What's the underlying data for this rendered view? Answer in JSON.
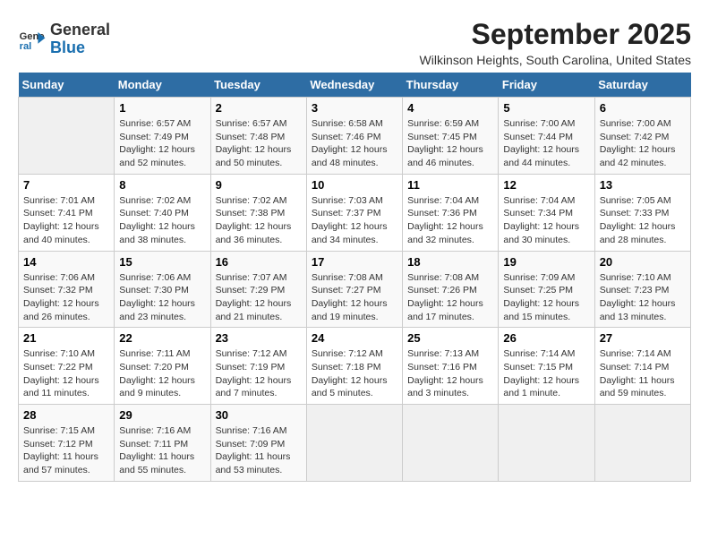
{
  "header": {
    "logo_line1": "General",
    "logo_line2": "Blue",
    "month": "September 2025",
    "location": "Wilkinson Heights, South Carolina, United States"
  },
  "days_of_week": [
    "Sunday",
    "Monday",
    "Tuesday",
    "Wednesday",
    "Thursday",
    "Friday",
    "Saturday"
  ],
  "weeks": [
    [
      {
        "day": "",
        "info": ""
      },
      {
        "day": "1",
        "info": "Sunrise: 6:57 AM\nSunset: 7:49 PM\nDaylight: 12 hours\nand 52 minutes."
      },
      {
        "day": "2",
        "info": "Sunrise: 6:57 AM\nSunset: 7:48 PM\nDaylight: 12 hours\nand 50 minutes."
      },
      {
        "day": "3",
        "info": "Sunrise: 6:58 AM\nSunset: 7:46 PM\nDaylight: 12 hours\nand 48 minutes."
      },
      {
        "day": "4",
        "info": "Sunrise: 6:59 AM\nSunset: 7:45 PM\nDaylight: 12 hours\nand 46 minutes."
      },
      {
        "day": "5",
        "info": "Sunrise: 7:00 AM\nSunset: 7:44 PM\nDaylight: 12 hours\nand 44 minutes."
      },
      {
        "day": "6",
        "info": "Sunrise: 7:00 AM\nSunset: 7:42 PM\nDaylight: 12 hours\nand 42 minutes."
      }
    ],
    [
      {
        "day": "7",
        "info": "Sunrise: 7:01 AM\nSunset: 7:41 PM\nDaylight: 12 hours\nand 40 minutes."
      },
      {
        "day": "8",
        "info": "Sunrise: 7:02 AM\nSunset: 7:40 PM\nDaylight: 12 hours\nand 38 minutes."
      },
      {
        "day": "9",
        "info": "Sunrise: 7:02 AM\nSunset: 7:38 PM\nDaylight: 12 hours\nand 36 minutes."
      },
      {
        "day": "10",
        "info": "Sunrise: 7:03 AM\nSunset: 7:37 PM\nDaylight: 12 hours\nand 34 minutes."
      },
      {
        "day": "11",
        "info": "Sunrise: 7:04 AM\nSunset: 7:36 PM\nDaylight: 12 hours\nand 32 minutes."
      },
      {
        "day": "12",
        "info": "Sunrise: 7:04 AM\nSunset: 7:34 PM\nDaylight: 12 hours\nand 30 minutes."
      },
      {
        "day": "13",
        "info": "Sunrise: 7:05 AM\nSunset: 7:33 PM\nDaylight: 12 hours\nand 28 minutes."
      }
    ],
    [
      {
        "day": "14",
        "info": "Sunrise: 7:06 AM\nSunset: 7:32 PM\nDaylight: 12 hours\nand 26 minutes."
      },
      {
        "day": "15",
        "info": "Sunrise: 7:06 AM\nSunset: 7:30 PM\nDaylight: 12 hours\nand 23 minutes."
      },
      {
        "day": "16",
        "info": "Sunrise: 7:07 AM\nSunset: 7:29 PM\nDaylight: 12 hours\nand 21 minutes."
      },
      {
        "day": "17",
        "info": "Sunrise: 7:08 AM\nSunset: 7:27 PM\nDaylight: 12 hours\nand 19 minutes."
      },
      {
        "day": "18",
        "info": "Sunrise: 7:08 AM\nSunset: 7:26 PM\nDaylight: 12 hours\nand 17 minutes."
      },
      {
        "day": "19",
        "info": "Sunrise: 7:09 AM\nSunset: 7:25 PM\nDaylight: 12 hours\nand 15 minutes."
      },
      {
        "day": "20",
        "info": "Sunrise: 7:10 AM\nSunset: 7:23 PM\nDaylight: 12 hours\nand 13 minutes."
      }
    ],
    [
      {
        "day": "21",
        "info": "Sunrise: 7:10 AM\nSunset: 7:22 PM\nDaylight: 12 hours\nand 11 minutes."
      },
      {
        "day": "22",
        "info": "Sunrise: 7:11 AM\nSunset: 7:20 PM\nDaylight: 12 hours\nand 9 minutes."
      },
      {
        "day": "23",
        "info": "Sunrise: 7:12 AM\nSunset: 7:19 PM\nDaylight: 12 hours\nand 7 minutes."
      },
      {
        "day": "24",
        "info": "Sunrise: 7:12 AM\nSunset: 7:18 PM\nDaylight: 12 hours\nand 5 minutes."
      },
      {
        "day": "25",
        "info": "Sunrise: 7:13 AM\nSunset: 7:16 PM\nDaylight: 12 hours\nand 3 minutes."
      },
      {
        "day": "26",
        "info": "Sunrise: 7:14 AM\nSunset: 7:15 PM\nDaylight: 12 hours\nand 1 minute."
      },
      {
        "day": "27",
        "info": "Sunrise: 7:14 AM\nSunset: 7:14 PM\nDaylight: 11 hours\nand 59 minutes."
      }
    ],
    [
      {
        "day": "28",
        "info": "Sunrise: 7:15 AM\nSunset: 7:12 PM\nDaylight: 11 hours\nand 57 minutes."
      },
      {
        "day": "29",
        "info": "Sunrise: 7:16 AM\nSunset: 7:11 PM\nDaylight: 11 hours\nand 55 minutes."
      },
      {
        "day": "30",
        "info": "Sunrise: 7:16 AM\nSunset: 7:09 PM\nDaylight: 11 hours\nand 53 minutes."
      },
      {
        "day": "",
        "info": ""
      },
      {
        "day": "",
        "info": ""
      },
      {
        "day": "",
        "info": ""
      },
      {
        "day": "",
        "info": ""
      }
    ]
  ]
}
